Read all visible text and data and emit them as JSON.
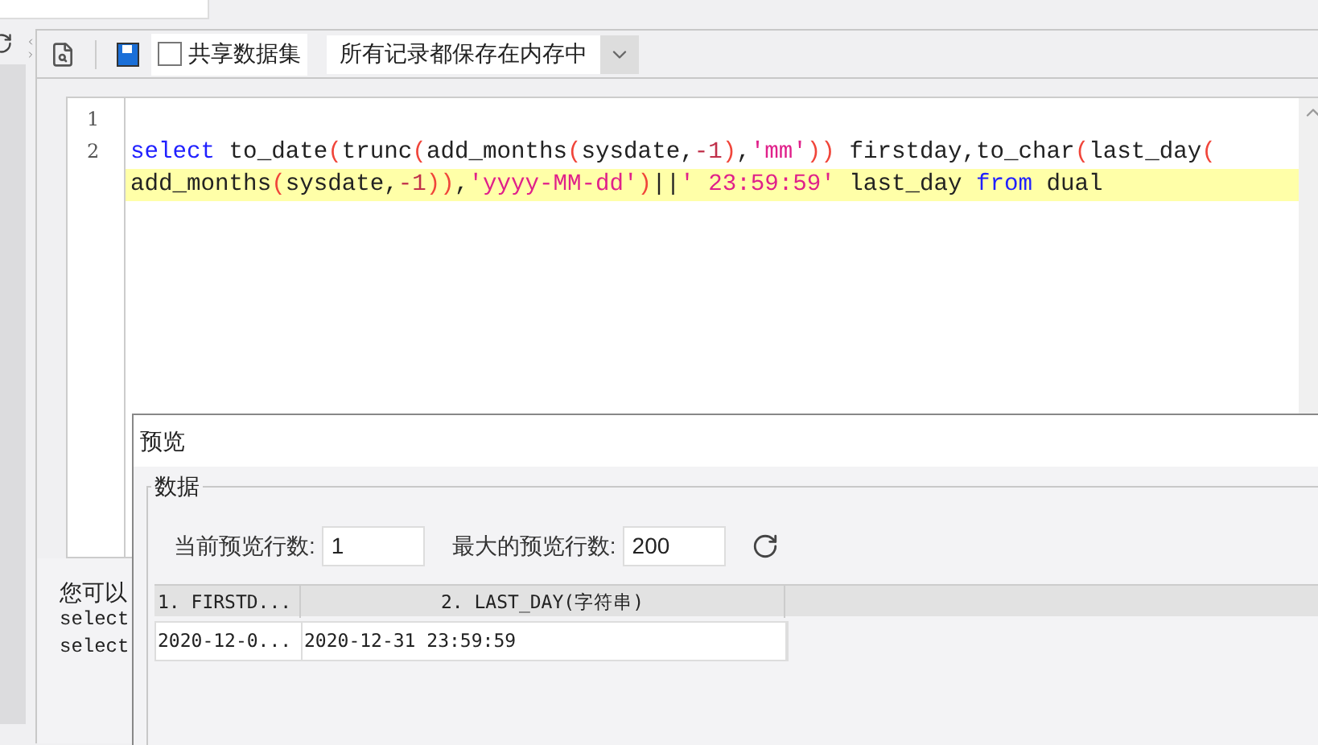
{
  "toolbar": {
    "share_checkbox": {
      "label": "共享数据集",
      "checked": false
    },
    "storage_dropdown": {
      "value": "所有记录都保存在内存中"
    }
  },
  "editor": {
    "lines": [
      {
        "number": "1"
      },
      {
        "number": "2",
        "rows": [
          {
            "highlighted": false,
            "tokens": [
              {
                "kind": "keyword",
                "text": "select"
              },
              {
                "kind": "plain",
                "text": " to_date"
              },
              {
                "kind": "paren",
                "text": "("
              },
              {
                "kind": "plain",
                "text": "trunc"
              },
              {
                "kind": "paren",
                "text": "("
              },
              {
                "kind": "plain",
                "text": "add_months"
              },
              {
                "kind": "paren",
                "text": "("
              },
              {
                "kind": "plain",
                "text": "sysdate,"
              },
              {
                "kind": "number",
                "text": "-1"
              },
              {
                "kind": "paren",
                "text": ")"
              },
              {
                "kind": "plain",
                "text": ","
              },
              {
                "kind": "string",
                "text": "'mm'"
              },
              {
                "kind": "paren",
                "text": "))"
              },
              {
                "kind": "plain",
                "text": " firstday,to_char"
              },
              {
                "kind": "paren",
                "text": "("
              },
              {
                "kind": "plain",
                "text": "last_day"
              },
              {
                "kind": "paren",
                "text": "("
              }
            ]
          },
          {
            "highlighted": true,
            "tokens": [
              {
                "kind": "plain",
                "text": "add_months"
              },
              {
                "kind": "paren",
                "text": "("
              },
              {
                "kind": "plain",
                "text": "sysdate,"
              },
              {
                "kind": "number",
                "text": "-1"
              },
              {
                "kind": "paren",
                "text": "))"
              },
              {
                "kind": "plain",
                "text": ","
              },
              {
                "kind": "string",
                "text": "'yyyy-MM-dd'"
              },
              {
                "kind": "paren",
                "text": ")"
              },
              {
                "kind": "plain",
                "text": "||"
              },
              {
                "kind": "string",
                "text": "' 23:59:59'"
              },
              {
                "kind": "plain",
                "text": " last_day "
              },
              {
                "kind": "keyword",
                "text": "from"
              },
              {
                "kind": "plain",
                "text": " dual"
              }
            ]
          }
        ]
      }
    ]
  },
  "message_panel": {
    "lines": [
      {
        "kind": "text",
        "text": "您可以"
      },
      {
        "kind": "code",
        "text": "select"
      },
      {
        "kind": "code",
        "text": "select"
      }
    ]
  },
  "preview_dialog": {
    "title": "预览",
    "group_title": "数据",
    "current_rows": {
      "label": "当前预览行数:",
      "value": "1"
    },
    "max_rows": {
      "label": "最大的预览行数:",
      "value": "200"
    },
    "table": {
      "columns": [
        "1. FIRSTD...",
        "2. LAST_DAY(字符串)"
      ],
      "rows": [
        [
          "2020-12-0...",
          "2020-12-31 23:59:59"
        ]
      ]
    }
  }
}
